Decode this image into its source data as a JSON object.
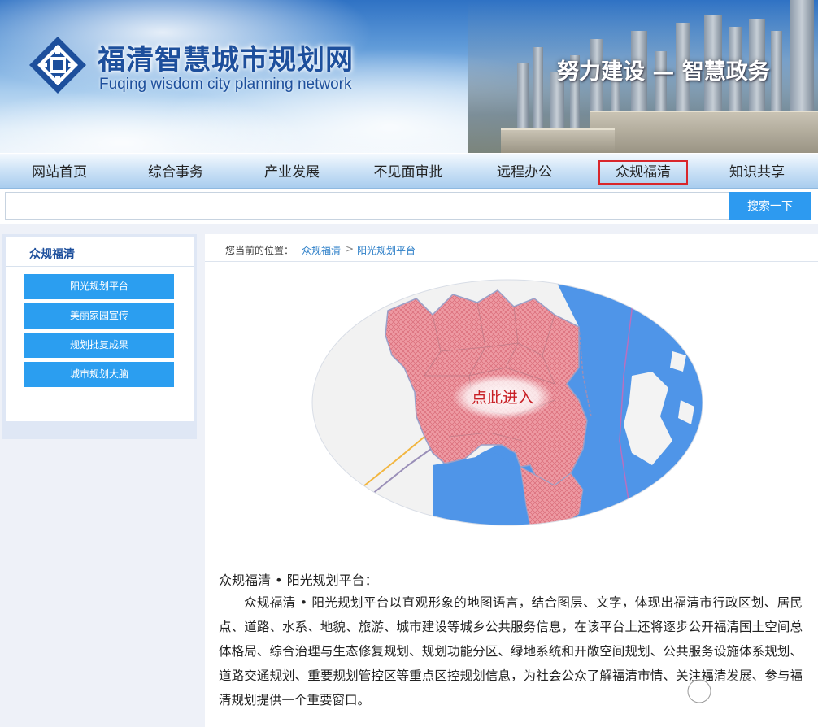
{
  "header": {
    "site_title": "福清智慧城市规划网",
    "site_subtitle": "Fuqing wisdom city planning network",
    "slogan": "努力建设 — 智慧政务"
  },
  "nav": {
    "items": [
      {
        "label": "网站首页"
      },
      {
        "label": "综合事务"
      },
      {
        "label": "产业发展"
      },
      {
        "label": "不见面审批"
      },
      {
        "label": "远程办公"
      },
      {
        "label": "众规福清",
        "active": true
      },
      {
        "label": "知识共享"
      }
    ]
  },
  "search": {
    "value": "",
    "button_label": "搜索一下"
  },
  "sidebar": {
    "title": "众规福清",
    "items": [
      {
        "label": "阳光规划平台"
      },
      {
        "label": "美丽家园宣传"
      },
      {
        "label": "规划批复成果"
      },
      {
        "label": "城市规划大脑"
      }
    ]
  },
  "breadcrumb": {
    "label": "您当前的位置：",
    "items": [
      "众规福清",
      "阳光规划平台"
    ],
    "separator": ">"
  },
  "map": {
    "overlay_label": "点此进入"
  },
  "article": {
    "title": "众规福清 • 阳光规划平台：",
    "body": "众规福清 • 阳光规划平台以直观形象的地图语言，结合图层、文字，体现出福清市行政区划、居民点、道路、水系、地貌、旅游、城市建设等城乡公共服务信息，在该平台上还将逐步公开福清国土空间总体格局、综合治理与生态修复规划、规划功能分区、绿地系统和开敞空间规划、公共服务设施体系规划、道路交通规划、重要规划管控区等重点区控规划信息，为社会公众了解福清市情、关注福清发展、参与福清规划提供一个重要窗口。"
  },
  "colors": {
    "title_blue": "#1d4f9c",
    "button_blue": "#2b9ef0",
    "active_border": "#d9262b",
    "link_blue": "#2d7fc8",
    "map_land": "#ee9aa3",
    "map_sea": "#4f95e8"
  }
}
